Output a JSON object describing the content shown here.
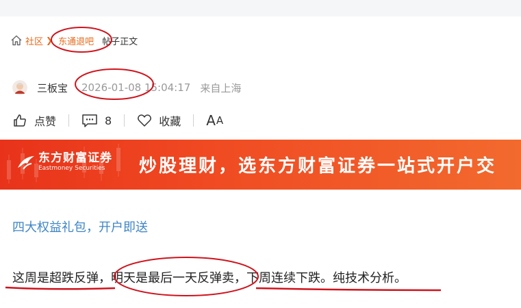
{
  "breadcrumb": {
    "items": [
      "社区",
      "东通退吧"
    ],
    "current": "帖子正文"
  },
  "post": {
    "author": "三板宝",
    "time": "2026-01-08 15:04:17",
    "source": "来自上海"
  },
  "actions": {
    "like": "点赞",
    "comments": "8",
    "favorite": "收藏",
    "font_big": "A",
    "font_small": "A"
  },
  "banner": {
    "brand_cn": "东方财富证券",
    "brand_en": "Eastmoney Securities",
    "slogan": "炒股理财，选东方财富证券一站式开户交"
  },
  "promo_link": "四大权益礼包，开户即送",
  "content": {
    "part1": "这周是超跌反弹，",
    "part2": "明天是最后一天反弹卖",
    "part3": "，",
    "part4": "下周连续下跌。纯技术分析。"
  },
  "colors": {
    "accent": "#e56a1c",
    "link": "#3d85c6",
    "banner": "#f04a22",
    "annotation": "#d0121b"
  }
}
